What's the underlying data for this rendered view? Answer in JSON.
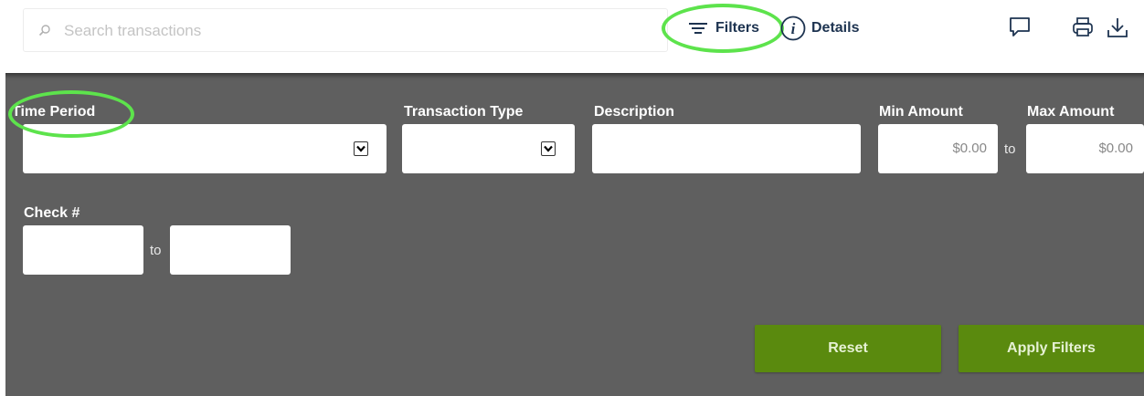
{
  "search": {
    "placeholder": "Search transactions",
    "icon": "search-icon"
  },
  "toolbar": {
    "filters_label": "Filters",
    "details_label": "Details",
    "icons": [
      "comment-icon",
      "print-icon",
      "download-icon"
    ]
  },
  "filters": {
    "time_period": {
      "label": "Time Period",
      "value": ""
    },
    "transaction_type": {
      "label": "Transaction Type",
      "value": ""
    },
    "description": {
      "label": "Description",
      "value": ""
    },
    "min_amount": {
      "label": "Min Amount",
      "value": "$0.00"
    },
    "max_amount": {
      "label": "Max Amount",
      "value": "$0.00"
    },
    "amount_to": "to",
    "check": {
      "label": "Check #",
      "from": "",
      "to": ""
    },
    "check_to": "to"
  },
  "actions": {
    "reset_label": "Reset",
    "apply_label": "Apply Filters"
  },
  "colors": {
    "panel_bg": "#5f5f5f",
    "button_green": "#5a8a0e",
    "highlight_green": "#5de34c",
    "link_navy": "#1d3350"
  }
}
